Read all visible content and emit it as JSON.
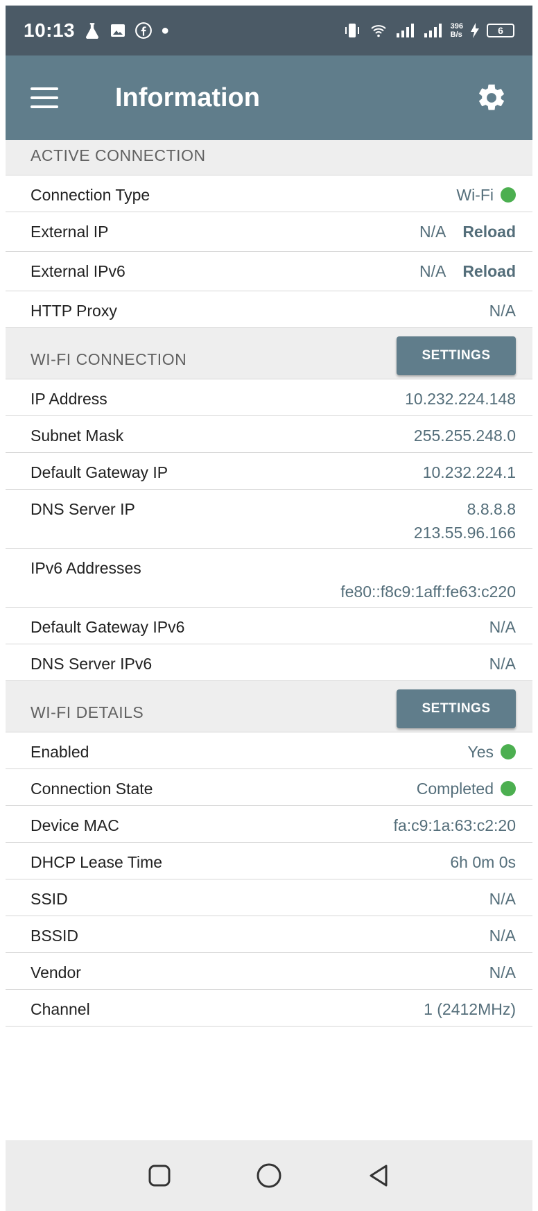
{
  "status_bar": {
    "time": "10:13",
    "speed_value": "396",
    "speed_unit": "B/s",
    "battery": "6"
  },
  "app_bar": {
    "title": "Information"
  },
  "sections": {
    "active": {
      "title": "ACTIVE CONNECTION",
      "rows": [
        {
          "label": "Connection Type",
          "value": "Wi-Fi"
        },
        {
          "label": "External IP",
          "value": "N/A",
          "action": "Reload"
        },
        {
          "label": "External IPv6",
          "value": "N/A",
          "action": "Reload"
        },
        {
          "label": "HTTP Proxy",
          "value": "N/A"
        }
      ]
    },
    "wifi_connection": {
      "title": "WI-FI CONNECTION",
      "button": "SETTINGS",
      "rows": [
        {
          "label": "IP Address",
          "value": "10.232.224.148"
        },
        {
          "label": "Subnet Mask",
          "value": "255.255.248.0"
        },
        {
          "label": "Default Gateway IP",
          "value": "10.232.224.1"
        },
        {
          "label": "DNS Server IP",
          "value": "8.8.8.8",
          "value2": "213.55.96.166"
        },
        {
          "label": "IPv6 Addresses",
          "value": "fe80::f8c9:1aff:fe63:c220"
        },
        {
          "label": "Default Gateway IPv6",
          "value": "N/A"
        },
        {
          "label": "DNS Server IPv6",
          "value": "N/A"
        }
      ]
    },
    "wifi_details": {
      "title": "WI-FI DETAILS",
      "button": "SETTINGS",
      "rows": [
        {
          "label": "Enabled",
          "value": "Yes"
        },
        {
          "label": "Connection State",
          "value": "Completed"
        },
        {
          "label": "Device MAC",
          "value": "fa:c9:1a:63:c2:20"
        },
        {
          "label": "DHCP Lease Time",
          "value": "6h 0m 0s"
        },
        {
          "label": "SSID",
          "value": "N/A"
        },
        {
          "label": "BSSID",
          "value": "N/A"
        },
        {
          "label": "Vendor",
          "value": "N/A"
        },
        {
          "label": "Channel",
          "value": "1 (2412MHz)"
        }
      ]
    }
  },
  "colors": {
    "app_bar": "#607d8b",
    "status_bar": "#4b5a66",
    "status_ok": "#4caf50",
    "value_text": "#546e7a"
  }
}
